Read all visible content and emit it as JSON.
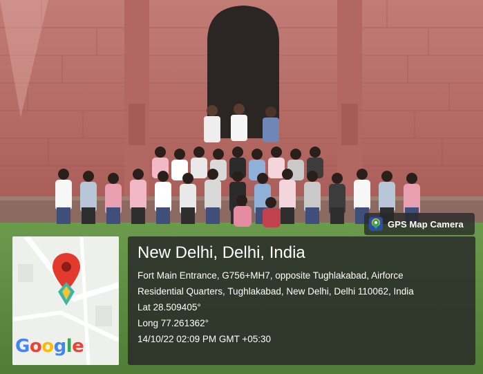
{
  "watermark": {
    "label": "GPS Map Camera",
    "icon": "map-camera-icon"
  },
  "map": {
    "logo_text": "Google",
    "pin_icon": "location-pin-icon"
  },
  "location": {
    "city": "New Delhi, Delhi, India",
    "address_line1": "Fort Main Entrance, G756+MH7, opposite Tughlakabad, Airforce",
    "address_line2": "Residential Quarters, Tughlakabad, New Delhi, Delhi 110062, India",
    "latitude": "Lat 28.509405°",
    "longitude": "Long 77.261362°",
    "datetime": "14/10/22 02:09 PM GMT +05:30"
  },
  "colors": {
    "wall": "#b56a64",
    "doorway": "#2b2624",
    "grass": "#5f8f44",
    "overlay": "#282828",
    "pin_red": "#e23b2e",
    "pin_teal": "#3bb6a6"
  }
}
